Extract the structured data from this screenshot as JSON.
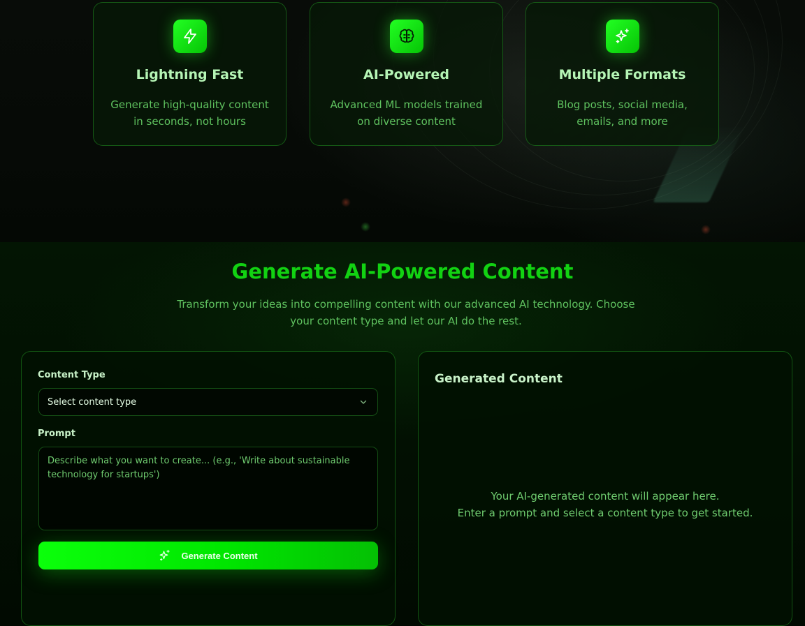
{
  "features": [
    {
      "icon": "lightning-icon",
      "title": "Lightning Fast",
      "desc": "Generate high-quality content in seconds, not hours"
    },
    {
      "icon": "brain-icon",
      "title": "AI-Powered",
      "desc": "Advanced ML models trained on diverse content"
    },
    {
      "icon": "sparkles-icon",
      "title": "Multiple Formats",
      "desc": "Blog posts, social media, emails, and more"
    }
  ],
  "generator": {
    "title": "Generate AI-Powered Content",
    "subtitle": "Transform your ideas into compelling content with our advanced AI technology. Choose your content type and let our AI do the rest.",
    "content_type_label": "Content Type",
    "content_type_value": "Select content type",
    "prompt_label": "Prompt",
    "prompt_placeholder": "Describe what you want to create... (e.g., 'Write about sustainable technology for startups')",
    "button_label": "Generate Content"
  },
  "output": {
    "title": "Generated Content",
    "empty_line1": "Your AI-generated content will appear here.",
    "empty_line2": "Enter a prompt and select a content type to get started."
  },
  "colors": {
    "accent": "#00e600",
    "heading": "#12d212",
    "text_muted": "#5fc25f",
    "background": "#010701"
  }
}
